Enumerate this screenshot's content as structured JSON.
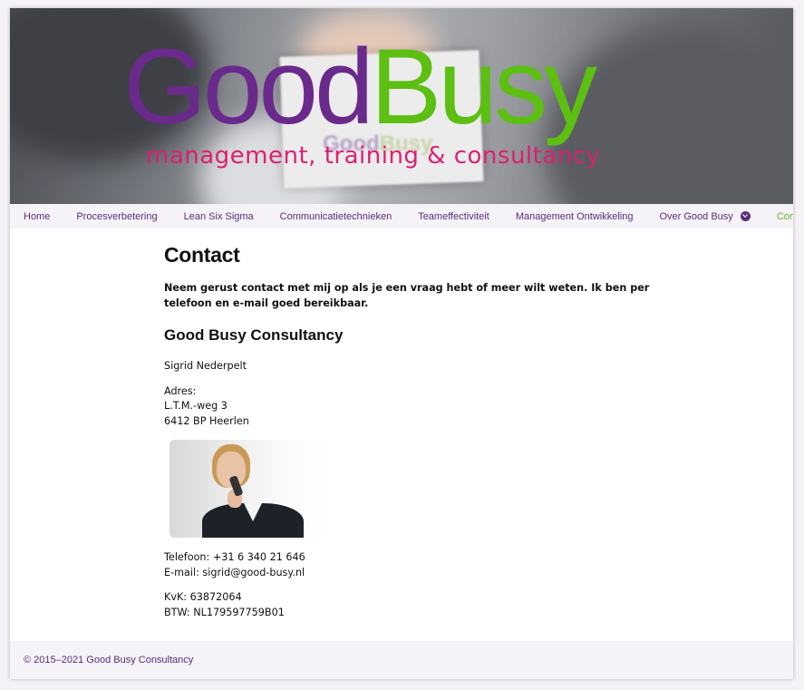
{
  "banner": {
    "logo_good": "Good",
    "logo_busy": "Busy",
    "tagline": "management, training & consultancy",
    "card_good": "Good",
    "card_busy": "Busy"
  },
  "nav": {
    "items": [
      {
        "label": "Home"
      },
      {
        "label": "Procesverbetering"
      },
      {
        "label": "Lean Six Sigma"
      },
      {
        "label": "Communicatietechnieken"
      },
      {
        "label": "Teameffectiviteit"
      },
      {
        "label": "Management Ontwikkeling"
      },
      {
        "label": "Over Good Busy",
        "icon": "chevron-down-icon"
      },
      {
        "label": "Contact",
        "active": true
      }
    ]
  },
  "content": {
    "title": "Contact",
    "intro": "Neem gerust contact met mij op als je een vraag hebt of meer wilt weten. Ik ben per telefoon en e-mail goed bereikbaar.",
    "company_heading": "Good Busy Consultancy",
    "name": "Sigrid Nederpelt",
    "address_label": "Adres:",
    "address_street": "L.T.M.-weg 3",
    "address_city": "6412 BP Heerlen",
    "phone": "Telefoon: +31 6 340 21 646",
    "email": "E-mail: sigrid@good-busy.nl",
    "kvk": "KvK: 63872064",
    "btw": "BTW: NL179597759B01"
  },
  "footer": {
    "copyright": "© 2015–2021 Good Busy Consultancy"
  },
  "colors": {
    "brand_purple": "#6a2a8c",
    "brand_green": "#5cbf12",
    "brand_pink": "#dc1f71",
    "nav_text": "#5a2d7a",
    "nav_active": "#66b52a",
    "nav_background": "#f5f2f8"
  }
}
